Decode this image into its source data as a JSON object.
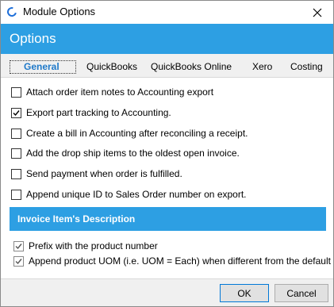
{
  "window": {
    "title": "Module Options"
  },
  "header": {
    "title": "Options"
  },
  "tabs": [
    {
      "label": "General",
      "active": true
    },
    {
      "label": "QuickBooks"
    },
    {
      "label": "QuickBooks Online"
    },
    {
      "label": "Xero"
    },
    {
      "label": "Costing"
    }
  ],
  "options": [
    {
      "label": "Attach order item notes to Accounting export",
      "checked": false
    },
    {
      "label": "Export part tracking to Accounting.",
      "checked": true
    },
    {
      "label": "Create a bill in Accounting after reconciling a receipt.",
      "checked": false
    },
    {
      "label": "Add the drop ship items to the oldest open invoice.",
      "checked": false
    },
    {
      "label": "Send payment when order is fulfilled.",
      "checked": false
    },
    {
      "label": "Append unique ID to Sales Order number on export.",
      "checked": false
    }
  ],
  "section": {
    "title": "Invoice Item's Description"
  },
  "description_options": [
    {
      "label": "Prefix with the product number",
      "checked": true
    },
    {
      "label": "Append product UOM (i.e. UOM = Each) when different from the default",
      "checked": true
    }
  ],
  "buttons": {
    "ok": "OK",
    "cancel": "Cancel"
  },
  "colors": {
    "accent": "#2d9fe3",
    "active_tab": "#1f79c9"
  }
}
